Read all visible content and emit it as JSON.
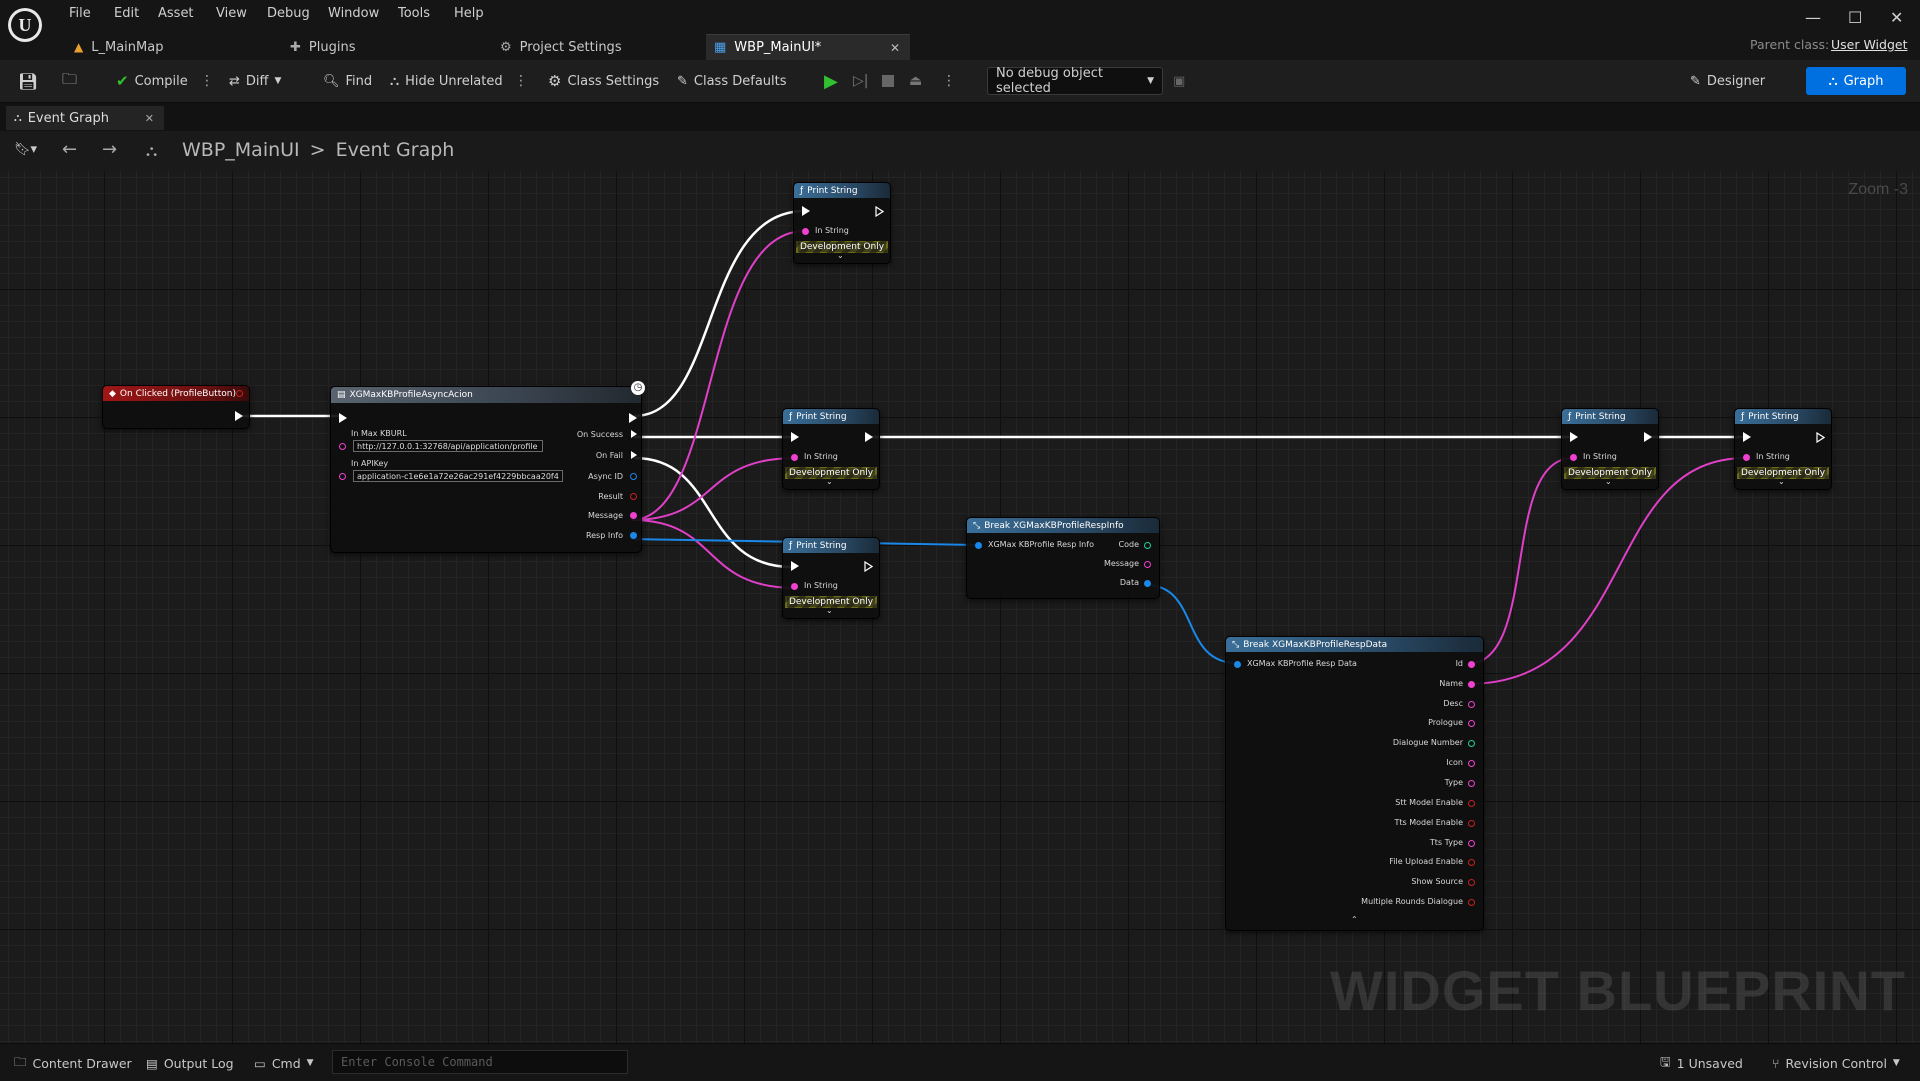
{
  "menu": [
    "File",
    "Edit",
    "Asset",
    "View",
    "Debug",
    "Window",
    "Tools",
    "Help"
  ],
  "tabs": [
    {
      "label": "L_MainMap",
      "icon": "level-icon"
    },
    {
      "label": "Plugins",
      "icon": "plugins-icon"
    },
    {
      "label": "Project Settings",
      "icon": "settings-icon"
    },
    {
      "label": "WBP_MainUI*",
      "icon": "widget-blueprint-icon",
      "active": true
    }
  ],
  "parent_class": {
    "label": "Parent class:",
    "value": "User Widget"
  },
  "toolbar": {
    "compile": "Compile",
    "diff": "Diff",
    "find": "Find",
    "hide_unrelated": "Hide Unrelated",
    "class_settings": "Class Settings",
    "class_defaults": "Class Defaults",
    "debug_object": "No debug object selected",
    "designer": "Designer",
    "graph": "Graph"
  },
  "doc_tab": {
    "label": "Event Graph"
  },
  "breadcrumb": {
    "root": "WBP_MainUI",
    "separator": ">",
    "current": "Event Graph"
  },
  "zoom": "Zoom -3",
  "watermark": "WIDGET BLUEPRINT",
  "nodes": {
    "on_clicked": {
      "title": "On Clicked (ProfileButton)"
    },
    "async": {
      "title": "XGMaxKBProfileAsyncAcion",
      "in_max_label": "In Max KBURL",
      "in_max_value": "http://127.0.0.1:32768/api/application/profile",
      "in_api_label": "In APIKey",
      "in_api_value": "application-c1e6e1a72e26ac291ef4229bbcaa20f4",
      "on_success": "On Success",
      "on_fail": "On Fail",
      "async_id": "Async ID",
      "result": "Result",
      "message": "Message",
      "resp_info": "Resp Info"
    },
    "print_string": {
      "title": "Print String",
      "in_string": "In String",
      "dev_only": "Development Only"
    },
    "break_info": {
      "title": "Break XGMaxKBProfileRespInfo",
      "input": "XGMax KBProfile Resp Info",
      "code": "Code",
      "message": "Message",
      "data": "Data"
    },
    "break_data": {
      "title": "Break XGMaxKBProfileRespData",
      "input": "XGMax KBProfile Resp Data",
      "outputs": [
        "Id",
        "Name",
        "Desc",
        "Prologue",
        "Dialogue Number",
        "Icon",
        "Type",
        "Stt Model Enable",
        "Tts Model Enable",
        "Tts Type",
        "File Upload Enable",
        "Show Source",
        "Multiple Rounds Dialogue"
      ]
    }
  },
  "status": {
    "content_drawer": "Content Drawer",
    "output_log": "Output Log",
    "cmd": "Cmd",
    "console_placeholder": "Enter Console Command",
    "unsaved": "1 Unsaved",
    "revision_control": "Revision Control"
  }
}
